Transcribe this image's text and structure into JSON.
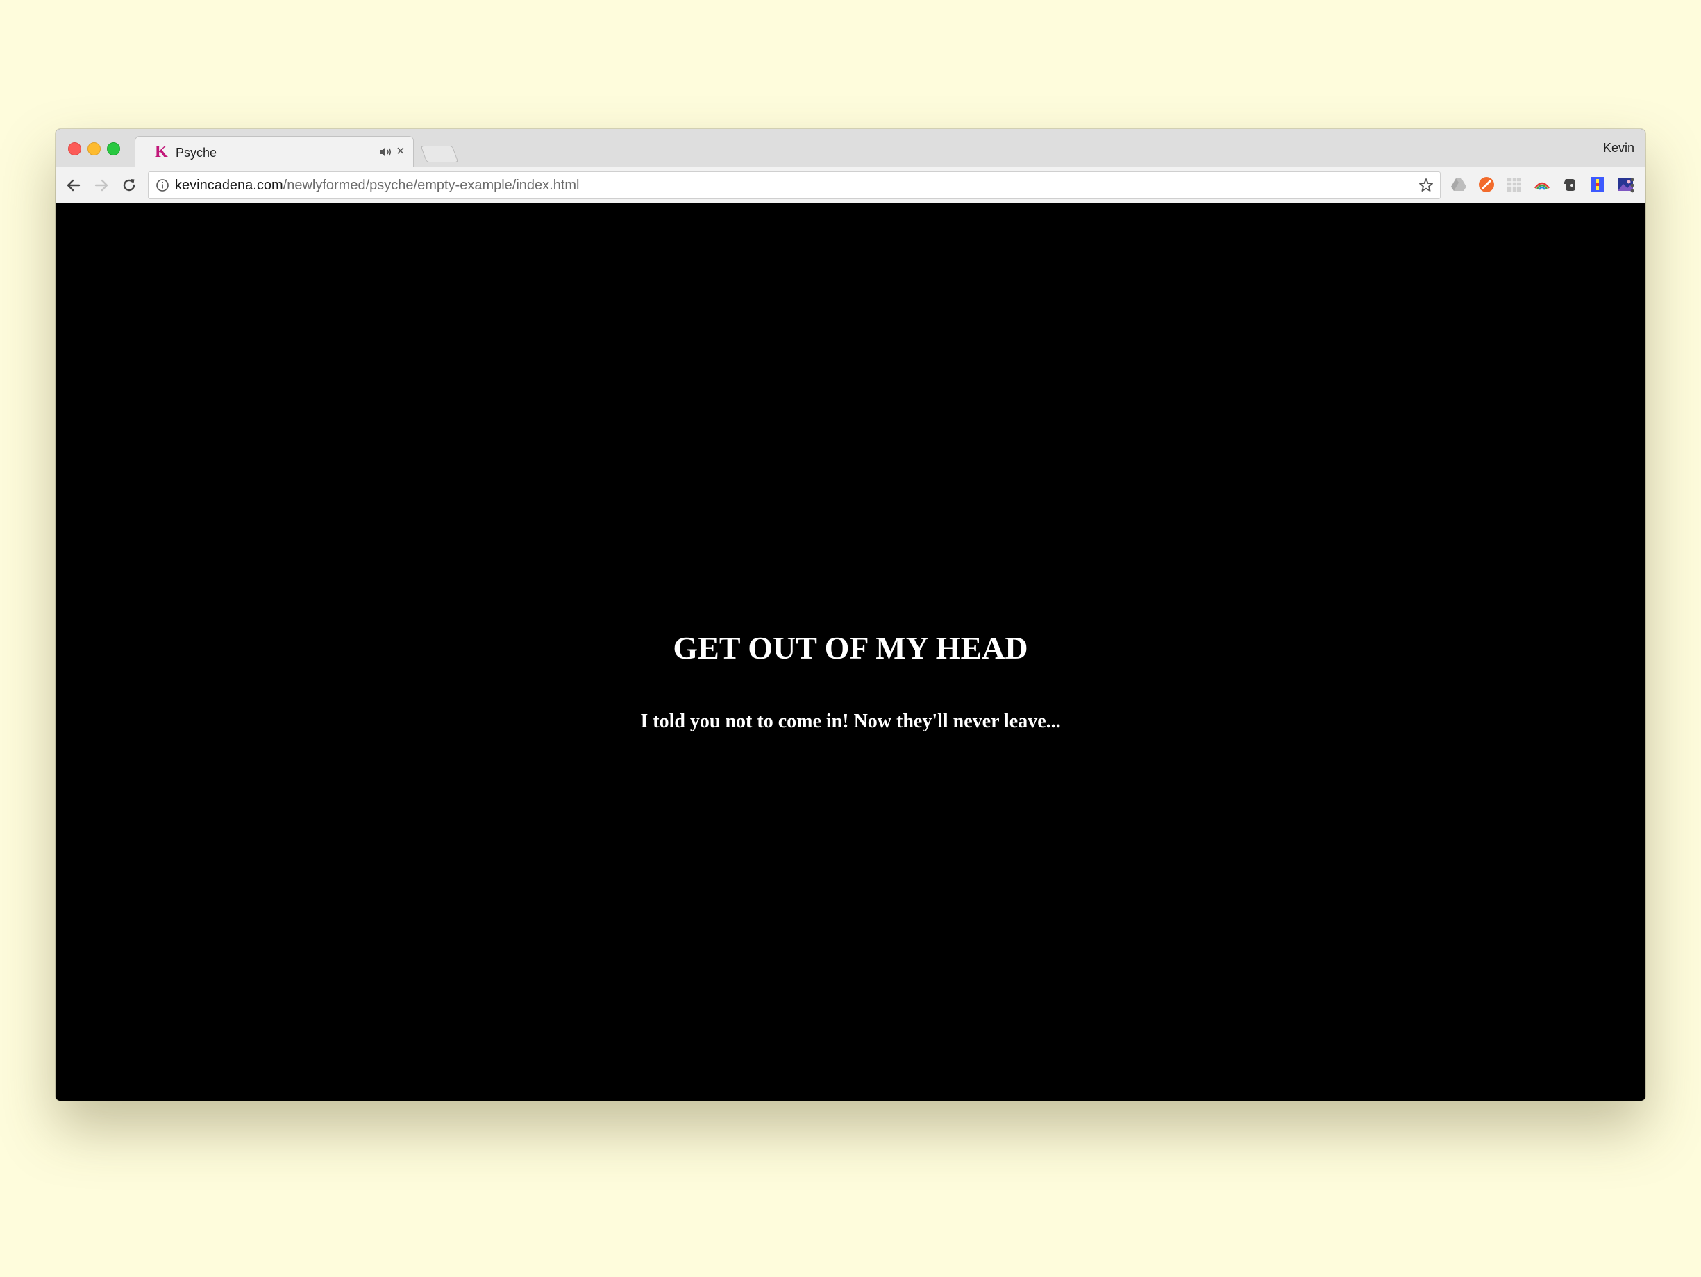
{
  "browser": {
    "tab": {
      "favicon_letter": "K",
      "title": "Psyche",
      "close_glyph": "×"
    },
    "profile_name": "Kevin",
    "address_bar": {
      "host": "kevincadena.com",
      "path": "/newlyformed/psyche/empty-example/index.html"
    },
    "extensions": [
      "google-drive-icon",
      "orange-extension-icon",
      "grid-extension-icon",
      "rainbow-arc-extension-icon",
      "evernote-icon",
      "blue-extension-icon",
      "image-extension-icon",
      "color-ring-extension-icon"
    ]
  },
  "page": {
    "heading": "GET OUT OF MY HEAD",
    "subheading": "I told you not to come in! Now they'll never leave..."
  },
  "colors": {
    "desktop_background": "#fefcdc",
    "page_background": "#000000",
    "page_text": "#ffffff",
    "favicon": "#c2187a"
  }
}
